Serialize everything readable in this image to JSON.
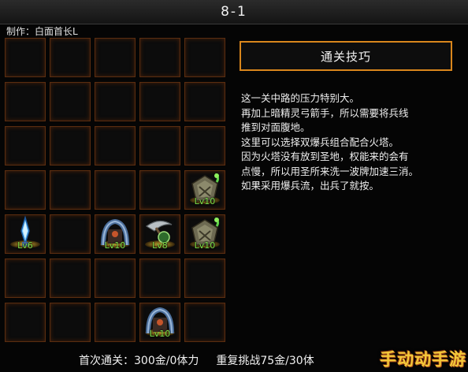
{
  "header": {
    "title": "8-1",
    "author": "制作：白面首长L"
  },
  "board": {
    "rows": 7,
    "cols": 5,
    "units": [
      {
        "row": 3,
        "col": 4,
        "level": "Lv10",
        "icon": "barracks-tower-icon"
      },
      {
        "row": 4,
        "col": 0,
        "level": "Lv6",
        "icon": "crystal-spire-icon"
      },
      {
        "row": 4,
        "col": 2,
        "level": "Lv10",
        "icon": "archer-arch-icon"
      },
      {
        "row": 4,
        "col": 3,
        "level": "Lv8",
        "icon": "scythe-tower-icon"
      },
      {
        "row": 4,
        "col": 4,
        "level": "Lv10",
        "icon": "barracks-tower-icon"
      },
      {
        "row": 6,
        "col": 3,
        "level": "Lv10",
        "icon": "archer-arch-icon"
      }
    ]
  },
  "tips": {
    "header": "通关技巧",
    "lines": [
      "这一关中路的压力特别大。",
      "再加上暗精灵弓箭手，所以需要将兵线",
      "推到对面腹地。",
      "这里可以选择双爆兵组合配合火塔。",
      "因为火塔没有放到圣地，权能来的会有",
      "点慢，所以用圣所来洗一波牌加速三消。",
      "如果采用爆兵流，出兵了就按。"
    ]
  },
  "footer": {
    "first_clear": "首次通关：300金/0体力",
    "repeat": "重复挑战75金/30体"
  },
  "watermark": "手动动手游",
  "colors": {
    "accent": "#d9861c",
    "cell_border": "#5a2d10",
    "level_text": "#7de04a",
    "background": "#050505"
  }
}
